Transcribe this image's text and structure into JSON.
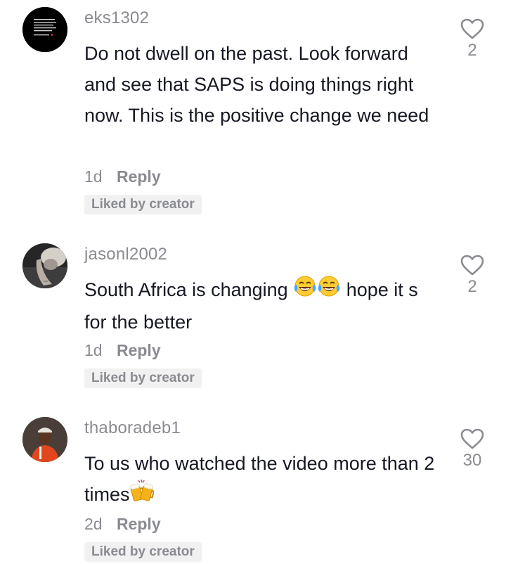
{
  "comments": [
    {
      "username": "eks1302",
      "text": "Do not dwell on the past. Look forward and see that SAPS is doing things right now. This is the positive change we need",
      "age": "1d",
      "reply_label": "Reply",
      "badge": "Liked by creator",
      "likes": "2",
      "avatar_icon": "text-quote-avatar"
    },
    {
      "username": "jasonl2002",
      "text_before": "South Africa is changing",
      "emojis": [
        "face-with-tears-of-joy-emoji",
        "face-with-tears-of-joy-emoji"
      ],
      "text_after": "hope it s for the better",
      "age": "1d",
      "reply_label": "Reply",
      "badge": "Liked by creator",
      "likes": "2",
      "avatar_icon": "person-photo-avatar"
    },
    {
      "username": "thaboradeb1",
      "text_before": "To us who watched the video more than 2 times",
      "emojis": [
        "clinking-beer-mugs-emoji"
      ],
      "age": "2d",
      "reply_label": "Reply",
      "badge": "Liked by creator",
      "likes": "30",
      "avatar_icon": "person-photo-avatar"
    }
  ],
  "colors": {
    "text": "#161823",
    "secondary": "#8a8b91",
    "badge_bg": "#f1f1f2"
  }
}
